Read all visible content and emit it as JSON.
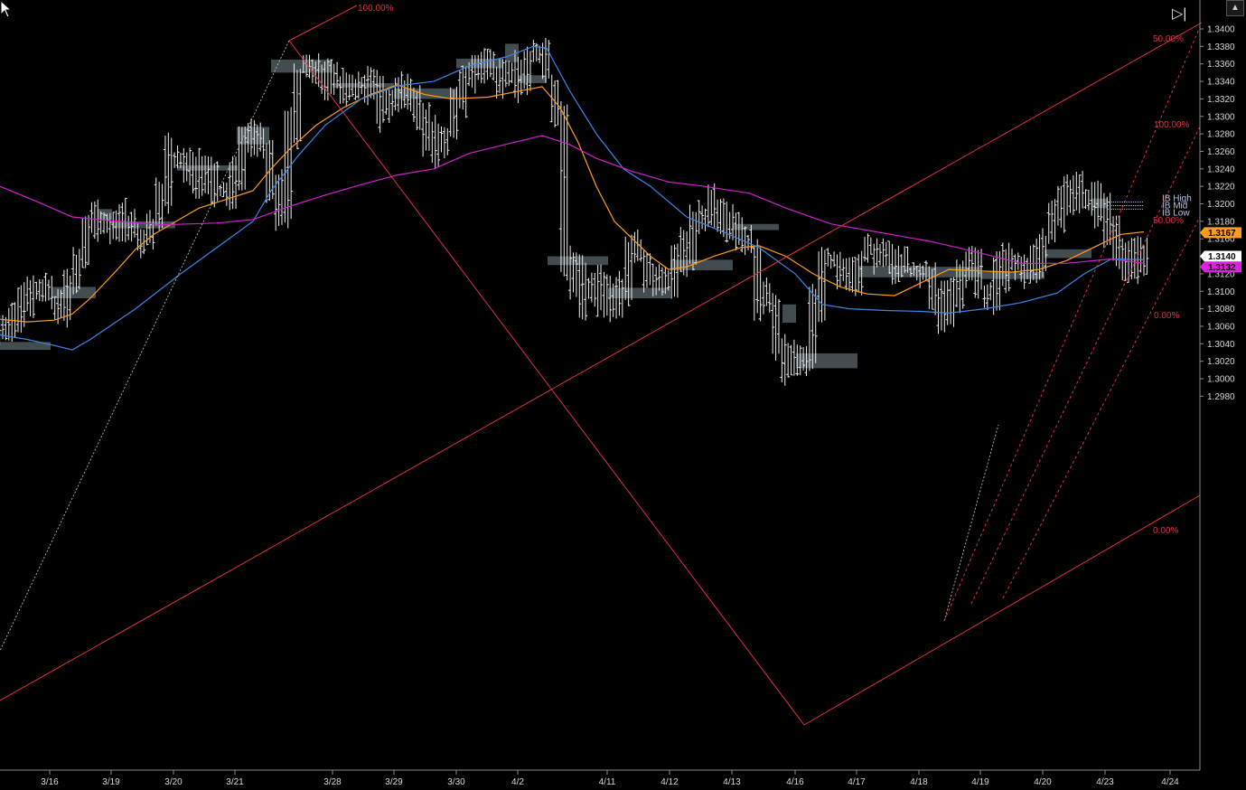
{
  "chart_data": {
    "type": "ohlc",
    "title": "",
    "xlabel": "",
    "ylabel": "",
    "ylim": [
      1.2975,
      1.3415
    ],
    "y_ticks": [
      "1.3400",
      "1.3380",
      "1.3360",
      "1.3340",
      "1.3320",
      "1.3300",
      "1.3280",
      "1.3260",
      "1.3240",
      "1.3220",
      "1.3200",
      "1.3180",
      "1.3160",
      "1.3140",
      "1.3120",
      "1.3100",
      "1.3080",
      "1.3060",
      "1.3040",
      "1.3020",
      "1.3000",
      "1.2980"
    ],
    "x_ticks": [
      "3/16",
      "3/19",
      "3/20",
      "3/21",
      "3/28",
      "3/29",
      "3/30",
      "4/2",
      "4/11",
      "4/12",
      "4/13",
      "4/16",
      "4/17",
      "4/18",
      "4/19",
      "4/20",
      "4/23",
      "4/24"
    ],
    "closes": [
      1.3055,
      1.307,
      1.3095,
      1.311,
      1.31,
      1.309,
      1.3075,
      1.3105,
      1.314,
      1.318,
      1.3188,
      1.3182,
      1.3178,
      1.3172,
      1.3168,
      1.316,
      1.3175,
      1.3215,
      1.3255,
      1.3245,
      1.324,
      1.323,
      1.3235,
      1.3205,
      1.322,
      1.324,
      1.327,
      1.3285,
      1.327,
      1.3215,
      1.3192,
      1.329,
      1.335,
      1.3365,
      1.335,
      1.334,
      1.333,
      1.333,
      1.3335,
      1.3345,
      1.333,
      1.3305,
      1.3315,
      1.333,
      1.3325,
      1.33,
      1.328,
      1.3265,
      1.3285,
      1.3315,
      1.334,
      1.3355,
      1.3365,
      1.3345,
      1.334,
      1.3335,
      1.335,
      1.3375,
      1.336,
      1.334,
      1.33,
      1.314,
      1.3115,
      1.309,
      1.3105,
      1.308,
      1.309,
      1.31,
      1.315,
      1.314,
      1.311,
      1.3105,
      1.312,
      1.3135,
      1.315,
      1.3175,
      1.3195,
      1.32,
      1.3185,
      1.317,
      1.3165,
      1.315,
      1.309,
      1.308,
      1.3035,
      1.3015,
      1.302,
      1.3025,
      1.309,
      1.314,
      1.3135,
      1.312,
      1.311,
      1.314,
      1.315,
      1.314,
      1.313,
      1.3125,
      1.313,
      1.312,
      1.3115,
      1.309,
      1.3075,
      1.31,
      1.3125,
      1.313,
      1.311,
      1.3095,
      1.312,
      1.314,
      1.3135,
      1.313,
      1.314,
      1.316,
      1.318,
      1.3205,
      1.322,
      1.321,
      1.32,
      1.3195,
      1.3175,
      1.315,
      1.3135,
      1.3125,
      1.314
    ],
    "series": [
      {
        "color": "#ff9c1a",
        "values": [
          [
            0,
            1.3068
          ],
          [
            30,
            1.3065
          ],
          [
            60,
            1.3067
          ],
          [
            80,
            1.3074
          ],
          [
            100,
            1.3092
          ],
          [
            130,
            1.3125
          ],
          [
            150,
            1.3148
          ],
          [
            170,
            1.3165
          ],
          [
            200,
            1.3183
          ],
          [
            220,
            1.3195
          ],
          [
            250,
            1.3205
          ],
          [
            280,
            1.3215
          ],
          [
            300,
            1.324
          ],
          [
            320,
            1.3262
          ],
          [
            350,
            1.329
          ],
          [
            380,
            1.331
          ],
          [
            410,
            1.3325
          ],
          [
            440,
            1.3336
          ],
          [
            470,
            1.3325
          ],
          [
            500,
            1.332
          ],
          [
            540,
            1.3322
          ],
          [
            570,
            1.3328
          ],
          [
            600,
            1.3334
          ],
          [
            620,
            1.331
          ],
          [
            640,
            1.327
          ],
          [
            660,
            1.322
          ],
          [
            680,
            1.318
          ],
          [
            700,
            1.316
          ],
          [
            720,
            1.314
          ],
          [
            740,
            1.3125
          ],
          [
            760,
            1.3128
          ],
          [
            790,
            1.314
          ],
          [
            820,
            1.315
          ],
          [
            840,
            1.3152
          ],
          [
            870,
            1.314
          ],
          [
            900,
            1.312
          ],
          [
            930,
            1.3105
          ],
          [
            960,
            1.3097
          ],
          [
            990,
            1.3095
          ],
          [
            1020,
            1.311
          ],
          [
            1050,
            1.3125
          ],
          [
            1090,
            1.3123
          ],
          [
            1120,
            1.3122
          ],
          [
            1150,
            1.3125
          ],
          [
            1180,
            1.3135
          ],
          [
            1210,
            1.315
          ],
          [
            1240,
            1.3165
          ],
          [
            1266,
            1.3168
          ]
        ]
      },
      {
        "color": "#3a86e8",
        "values": [
          [
            0,
            1.305
          ],
          [
            30,
            1.3045
          ],
          [
            60,
            1.3038
          ],
          [
            80,
            1.3033
          ],
          [
            100,
            1.3045
          ],
          [
            150,
            1.308
          ],
          [
            200,
            1.312
          ],
          [
            240,
            1.315
          ],
          [
            280,
            1.318
          ],
          [
            300,
            1.3215
          ],
          [
            330,
            1.3255
          ],
          [
            360,
            1.329
          ],
          [
            400,
            1.332
          ],
          [
            440,
            1.3335
          ],
          [
            480,
            1.334
          ],
          [
            520,
            1.3358
          ],
          [
            560,
            1.3368
          ],
          [
            590,
            1.338
          ],
          [
            605,
            1.3378
          ],
          [
            630,
            1.333
          ],
          [
            660,
            1.328
          ],
          [
            690,
            1.324
          ],
          [
            720,
            1.322
          ],
          [
            760,
            1.3185
          ],
          [
            800,
            1.3168
          ],
          [
            840,
            1.315
          ],
          [
            880,
            1.312
          ],
          [
            910,
            1.3085
          ],
          [
            940,
            1.308
          ],
          [
            980,
            1.3078
          ],
          [
            1020,
            1.3077
          ],
          [
            1050,
            1.3075
          ],
          [
            1090,
            1.308
          ],
          [
            1130,
            1.3087
          ],
          [
            1170,
            1.3098
          ],
          [
            1200,
            1.312
          ],
          [
            1230,
            1.3137
          ],
          [
            1266,
            1.3136
          ]
        ]
      },
      {
        "color": "#d020d0",
        "values": [
          [
            0,
            1.322
          ],
          [
            40,
            1.3203
          ],
          [
            80,
            1.3185
          ],
          [
            130,
            1.318
          ],
          [
            180,
            1.3176
          ],
          [
            240,
            1.3178
          ],
          [
            280,
            1.3182
          ],
          [
            320,
            1.3197
          ],
          [
            360,
            1.321
          ],
          [
            400,
            1.3222
          ],
          [
            440,
            1.3233
          ],
          [
            480,
            1.324
          ],
          [
            520,
            1.3258
          ],
          [
            560,
            1.3268
          ],
          [
            600,
            1.3278
          ],
          [
            630,
            1.3268
          ],
          [
            660,
            1.3252
          ],
          [
            700,
            1.3237
          ],
          [
            740,
            1.3225
          ],
          [
            780,
            1.322
          ],
          [
            830,
            1.3212
          ],
          [
            870,
            1.3195
          ],
          [
            920,
            1.3177
          ],
          [
            970,
            1.3168
          ],
          [
            1030,
            1.3157
          ],
          [
            1080,
            1.3145
          ],
          [
            1130,
            1.3132
          ],
          [
            1180,
            1.3132
          ],
          [
            1230,
            1.3137
          ],
          [
            1266,
            1.3132
          ]
        ]
      }
    ],
    "price_tags": [
      {
        "label": "1.3167",
        "color": "#ff9c1a",
        "text_color": "#000000",
        "value": 1.3167
      },
      {
        "label": "1.3140",
        "color": "#ffffff",
        "text_color": "#000000",
        "value": 1.314
      },
      {
        "label": "1.3132",
        "color": "#e020e0",
        "text_color": "#000000",
        "value": 1.3132
      }
    ],
    "fib_labels": [
      "100.00%",
      "50.00%",
      "100.00%",
      "50.00%",
      "0.00%",
      "0.00%"
    ],
    "ib_labels": [
      "IB High",
      "IB Mid",
      "IB Low"
    ],
    "colors": {
      "background": "#000000",
      "bars": "#f0f0f0",
      "trendline": "#e03040",
      "ib_box": "#7a8a90"
    }
  },
  "controls": {
    "scroll_icon": "▲",
    "end_icon": "▷|"
  }
}
